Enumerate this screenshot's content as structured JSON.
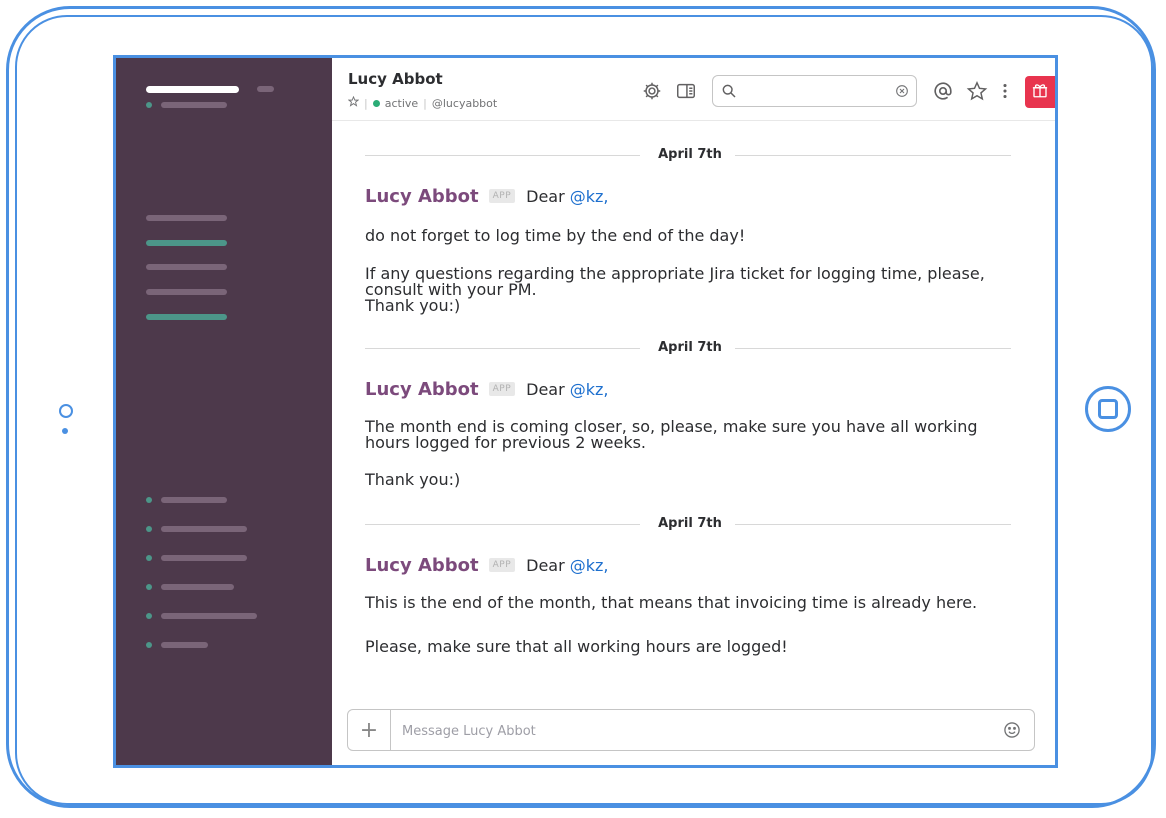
{
  "channel": {
    "title": "Lucy Abbot",
    "status": "active",
    "handle": "@lucyabbot"
  },
  "header": {
    "search": {
      "value": "",
      "placeholder": ""
    },
    "icons": [
      "gear-icon",
      "sidebar-toggle-icon",
      "search-icon",
      "clear-icon",
      "mention-icon",
      "star-icon",
      "more-vertical-icon",
      "gift-icon"
    ]
  },
  "messages": [
    {
      "date": "April 7th",
      "author": "Lucy Abbot",
      "badge": "APP",
      "greeting": "Dear",
      "mention": "@kz,",
      "paragraphs": [
        "do not forget to log time by the end of the day!",
        "If any questions regarding the appropriate Jira ticket for logging time, please, consult with your PM.",
        "Thank you:)"
      ]
    },
    {
      "date": "April 7th",
      "author": "Lucy Abbot",
      "badge": "APP",
      "greeting": "Dear",
      "mention": "@kz,",
      "paragraphs": [
        "The month end is coming closer, so, please, make sure you have all working hours logged for previous 2 weeks.",
        "Thank you:)"
      ]
    },
    {
      "date": "April 7th",
      "author": "Lucy Abbot",
      "badge": "APP",
      "greeting": "Dear",
      "mention": "@kz,",
      "paragraphs": [
        "This is the end of the month, that means that invoicing time is already here.",
        "Please, make sure that all working hours are logged!"
      ]
    }
  ],
  "composer": {
    "placeholder": "Message Lucy Abbot",
    "value": ""
  },
  "colors": {
    "sidebar": "#4d394b",
    "accent_green": "#4c9689",
    "author": "#7c4a7c",
    "mention": "#1d6fce",
    "gift": "#e8344e",
    "device_outline": "#4a90e2"
  }
}
